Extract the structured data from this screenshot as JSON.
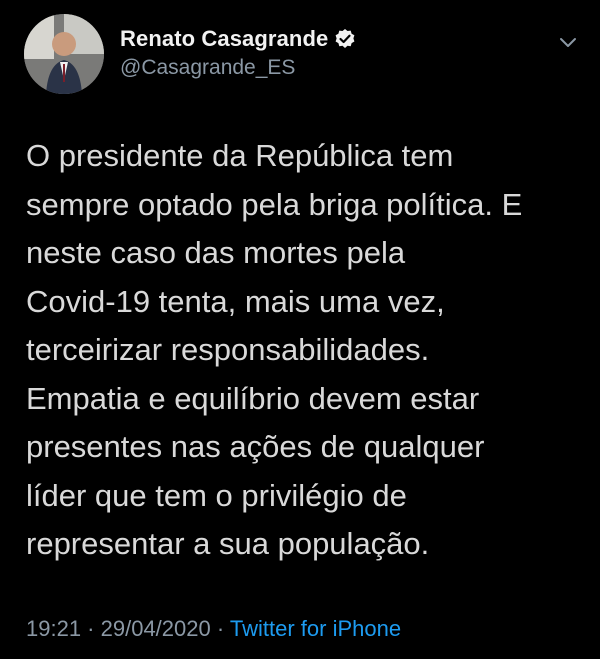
{
  "author": {
    "display_name": "Renato Casagrande",
    "handle": "@Casagrande_ES",
    "verified": true
  },
  "tweet": {
    "lines": [
      "O presidente da República tem",
      "sempre optado pela briga política. E",
      "neste caso das mortes pela",
      "Covid-19 tenta, mais uma vez,",
      "terceirizar responsabilidades.",
      "Empatia e equilíbrio devem estar",
      "presentes nas ações de qualquer",
      "líder que tem o privilégio de",
      "representar a sua população."
    ]
  },
  "meta": {
    "time": "19:21",
    "separator1": " · ",
    "date": "29/04/2020",
    "separator2": " · ",
    "source": "Twitter for iPhone"
  },
  "icons": {
    "verified": "verified-badge-icon",
    "more": "chevron-down-icon"
  },
  "colors": {
    "background": "#000000",
    "text": "#d9d9d9",
    "secondary": "#8b98a5",
    "link": "#1d9bf0"
  }
}
